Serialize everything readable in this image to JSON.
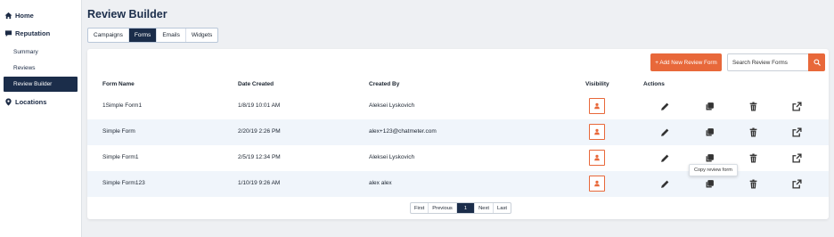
{
  "sidebar": {
    "home_label": "Home",
    "reputation_label": "Reputation",
    "items": [
      {
        "label": "Summary"
      },
      {
        "label": "Reviews"
      },
      {
        "label": "Review Builder"
      }
    ],
    "locations_label": "Locations",
    "active_item": "Review Builder"
  },
  "header": {
    "title": "Review Builder"
  },
  "tabs": [
    {
      "label": "Campaigns"
    },
    {
      "label": "Forms"
    },
    {
      "label": "Emails"
    },
    {
      "label": "Widgets"
    }
  ],
  "active_tab": "Forms",
  "toolbar": {
    "add_label": "+ Add New Review Form",
    "search_placeholder": "Search Review Forms"
  },
  "table": {
    "columns": [
      "Form Name",
      "Date Created",
      "Created By",
      "Visibility",
      "Actions"
    ],
    "rows": [
      {
        "name": "1Simple Form1",
        "date": "1/8/19 10:01 AM",
        "by": "Aleksei Lyskovich"
      },
      {
        "name": "Simple Form",
        "date": "2/20/19 2:26 PM",
        "by": "alex+123@chatmeter.com"
      },
      {
        "name": "Simple Form1",
        "date": "2/5/19 12:34 PM",
        "by": "Aleksei Lyskovich"
      },
      {
        "name": "Simple Form123",
        "date": "1/10/19 9:26 AM",
        "by": "alex alex"
      }
    ]
  },
  "tooltip": {
    "text": "Copy review form"
  },
  "pagination": {
    "first": "First",
    "previous": "Previous",
    "current": "1",
    "next": "Next",
    "last": "Last"
  },
  "colors": {
    "accent": "#e8683a",
    "navy": "#1b2d4a",
    "row_alt": "#f0f5fb"
  },
  "icons": [
    "home-icon",
    "reputation-icon",
    "location-pin-icon",
    "search-icon",
    "person-icon",
    "edit-icon",
    "copy-icon",
    "trash-icon",
    "external-link-icon"
  ]
}
